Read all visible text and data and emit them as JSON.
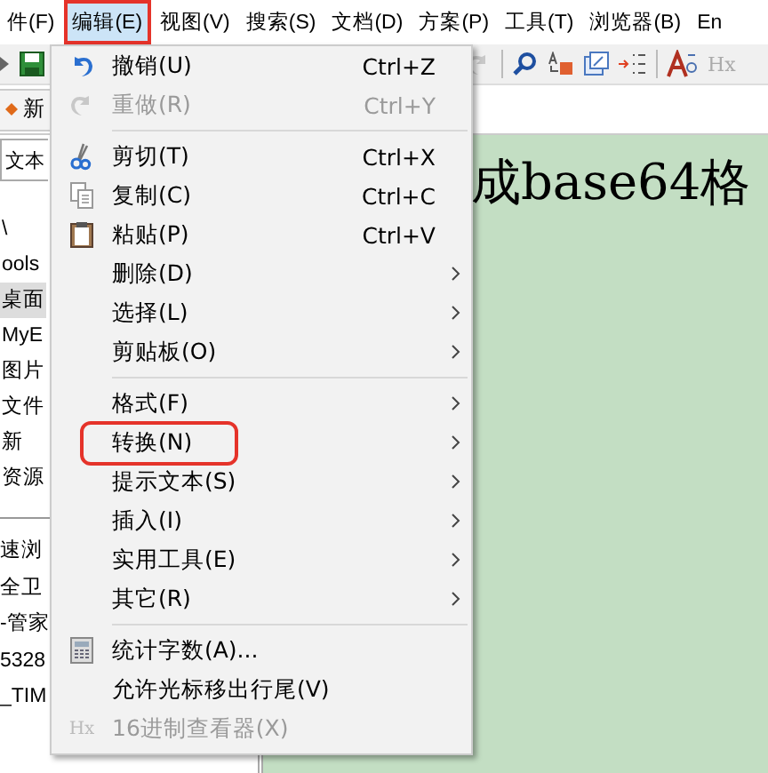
{
  "menubar": [
    {
      "label": "件(F)",
      "selected": false,
      "annotated": false
    },
    {
      "label": "编辑(E)",
      "selected": true,
      "annotated": true
    },
    {
      "label": "视图(V)",
      "selected": false,
      "annotated": false
    },
    {
      "label": "搜索(S)",
      "selected": false,
      "annotated": false
    },
    {
      "label": "文档(D)",
      "selected": false,
      "annotated": false
    },
    {
      "label": "方案(P)",
      "selected": false,
      "annotated": false
    },
    {
      "label": "工具(T)",
      "selected": false,
      "annotated": false
    },
    {
      "label": "浏览器(B)",
      "selected": false,
      "annotated": false
    },
    {
      "label": "En",
      "selected": false,
      "annotated": false
    }
  ],
  "toolbar": {
    "hex_label": "Hx"
  },
  "document_tab": {
    "label": "新"
  },
  "left_panel": {
    "filter": "文本",
    "tree": [
      {
        "label": "\\",
        "selected": false
      },
      {
        "label": "ools",
        "selected": false
      },
      {
        "label": "桌面",
        "selected": true
      },
      {
        "label": "MyE",
        "selected": false
      },
      {
        "label": "图片",
        "selected": false
      },
      {
        "label": "文件",
        "selected": false
      },
      {
        "label": "新",
        "selected": false
      },
      {
        "label": "资源",
        "selected": false
      }
    ],
    "files": [
      "速浏",
      "全卫",
      "-管家",
      "5328",
      "_TIM"
    ]
  },
  "editor": {
    "text": "成base64格"
  },
  "edit_menu": [
    {
      "kind": "command",
      "label": "撤销(U)",
      "shortcut": "Ctrl+Z",
      "disabled": false,
      "annotated": false
    },
    {
      "kind": "command",
      "label": "重做(R)",
      "shortcut": "Ctrl+Y",
      "disabled": true,
      "annotated": false
    },
    {
      "kind": "separator"
    },
    {
      "kind": "command",
      "label": "剪切(T)",
      "shortcut": "Ctrl+X",
      "disabled": false,
      "annotated": false
    },
    {
      "kind": "command",
      "label": "复制(C)",
      "shortcut": "Ctrl+C",
      "disabled": false,
      "annotated": false
    },
    {
      "kind": "command",
      "label": "粘贴(P)",
      "shortcut": "Ctrl+V",
      "disabled": false,
      "annotated": false
    },
    {
      "kind": "submenu",
      "label": "删除(D)",
      "disabled": false,
      "annotated": false
    },
    {
      "kind": "submenu",
      "label": "选择(L)",
      "disabled": false,
      "annotated": false
    },
    {
      "kind": "submenu",
      "label": "剪贴板(O)",
      "disabled": false,
      "annotated": false
    },
    {
      "kind": "separator"
    },
    {
      "kind": "submenu",
      "label": "格式(F)",
      "disabled": false,
      "annotated": false
    },
    {
      "kind": "submenu",
      "label": "转换(N)",
      "disabled": false,
      "annotated": true
    },
    {
      "kind": "submenu",
      "label": "提示文本(S)",
      "disabled": false,
      "annotated": false
    },
    {
      "kind": "submenu",
      "label": "插入(I)",
      "disabled": false,
      "annotated": false
    },
    {
      "kind": "submenu",
      "label": "实用工具(E)",
      "disabled": false,
      "annotated": false
    },
    {
      "kind": "submenu",
      "label": "其它(R)",
      "disabled": false,
      "annotated": false
    },
    {
      "kind": "separator"
    },
    {
      "kind": "command",
      "label": "统计字数(A)...",
      "disabled": false,
      "annotated": false
    },
    {
      "kind": "command",
      "label": "允许光标移出行尾(V)",
      "disabled": false,
      "annotated": false
    },
    {
      "kind": "command",
      "label": "16进制查看器(X)",
      "icon_text": "Hx",
      "disabled": true,
      "annotated": false
    }
  ]
}
